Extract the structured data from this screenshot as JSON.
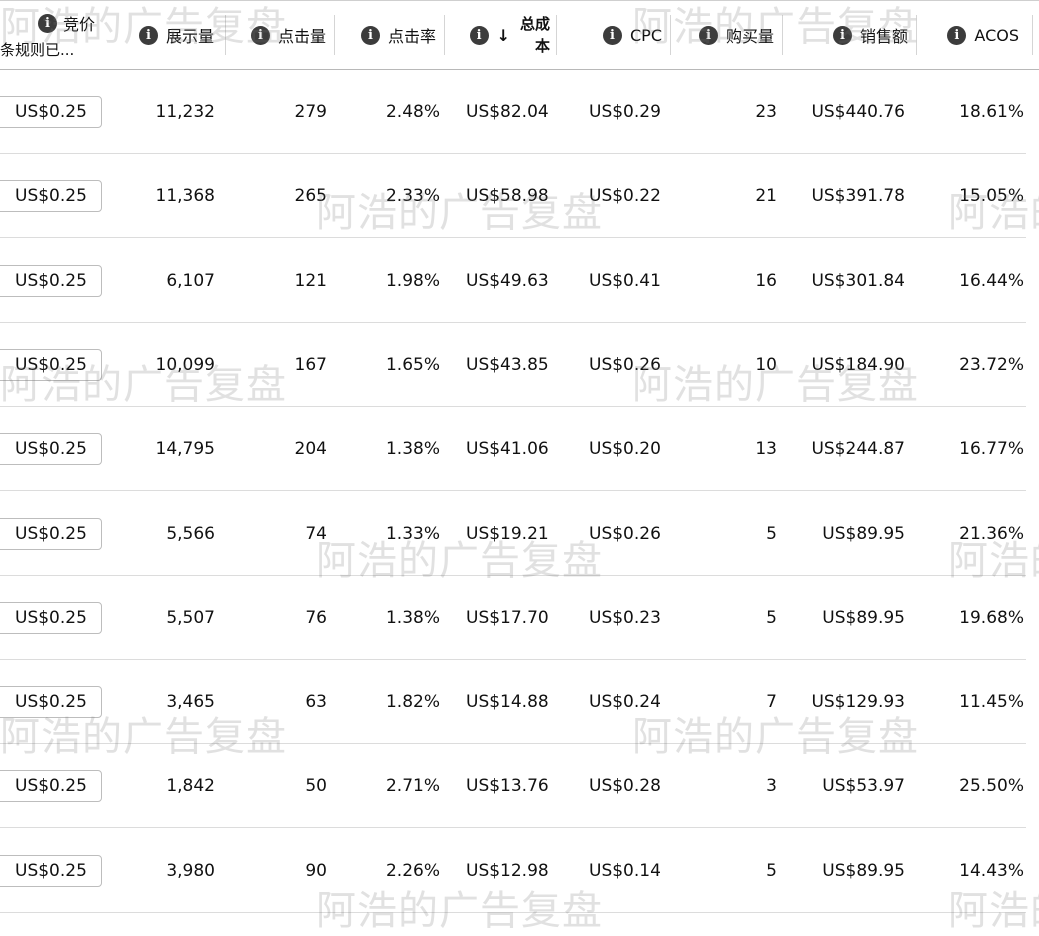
{
  "header": {
    "bid": {
      "label": "竞价",
      "sublabel": "条规则已..."
    },
    "columns": [
      {
        "key": "impressions",
        "label": "展示量"
      },
      {
        "key": "clicks",
        "label": "点击量"
      },
      {
        "key": "ctr",
        "label": "点击率"
      },
      {
        "key": "total_cost",
        "label_line1": "总成",
        "label_line2": "本",
        "sort": "descending"
      },
      {
        "key": "cpc",
        "label": "CPC"
      },
      {
        "key": "purchases",
        "label": "购买量"
      },
      {
        "key": "sales",
        "label": "销售额"
      },
      {
        "key": "acos",
        "label": "ACOS"
      }
    ],
    "info_glyph": "i"
  },
  "rows": [
    {
      "bid": "US$0.25",
      "impressions": "11,232",
      "clicks": "279",
      "ctr": "2.48%",
      "total_cost": "US$82.04",
      "cpc": "US$0.29",
      "purchases": "23",
      "sales": "US$440.76",
      "acos": "18.61%"
    },
    {
      "bid": "US$0.25",
      "impressions": "11,368",
      "clicks": "265",
      "ctr": "2.33%",
      "total_cost": "US$58.98",
      "cpc": "US$0.22",
      "purchases": "21",
      "sales": "US$391.78",
      "acos": "15.05%"
    },
    {
      "bid": "US$0.25",
      "impressions": "6,107",
      "clicks": "121",
      "ctr": "1.98%",
      "total_cost": "US$49.63",
      "cpc": "US$0.41",
      "purchases": "16",
      "sales": "US$301.84",
      "acos": "16.44%"
    },
    {
      "bid": "US$0.25",
      "impressions": "10,099",
      "clicks": "167",
      "ctr": "1.65%",
      "total_cost": "US$43.85",
      "cpc": "US$0.26",
      "purchases": "10",
      "sales": "US$184.90",
      "acos": "23.72%"
    },
    {
      "bid": "US$0.25",
      "impressions": "14,795",
      "clicks": "204",
      "ctr": "1.38%",
      "total_cost": "US$41.06",
      "cpc": "US$0.20",
      "purchases": "13",
      "sales": "US$244.87",
      "acos": "16.77%"
    },
    {
      "bid": "US$0.25",
      "impressions": "5,566",
      "clicks": "74",
      "ctr": "1.33%",
      "total_cost": "US$19.21",
      "cpc": "US$0.26",
      "purchases": "5",
      "sales": "US$89.95",
      "acos": "21.36%"
    },
    {
      "bid": "US$0.25",
      "impressions": "5,507",
      "clicks": "76",
      "ctr": "1.38%",
      "total_cost": "US$17.70",
      "cpc": "US$0.23",
      "purchases": "5",
      "sales": "US$89.95",
      "acos": "19.68%"
    },
    {
      "bid": "US$0.25",
      "impressions": "3,465",
      "clicks": "63",
      "ctr": "1.82%",
      "total_cost": "US$14.88",
      "cpc": "US$0.24",
      "purchases": "7",
      "sales": "US$129.93",
      "acos": "11.45%"
    },
    {
      "bid": "US$0.25",
      "impressions": "1,842",
      "clicks": "50",
      "ctr": "2.71%",
      "total_cost": "US$13.76",
      "cpc": "US$0.28",
      "purchases": "3",
      "sales": "US$53.97",
      "acos": "25.50%"
    },
    {
      "bid": "US$0.25",
      "impressions": "3,980",
      "clicks": "90",
      "ctr": "2.26%",
      "total_cost": "US$12.98",
      "cpc": "US$0.14",
      "purchases": "5",
      "sales": "US$89.95",
      "acos": "14.43%"
    }
  ],
  "watermark": "阿浩的广告复盘"
}
